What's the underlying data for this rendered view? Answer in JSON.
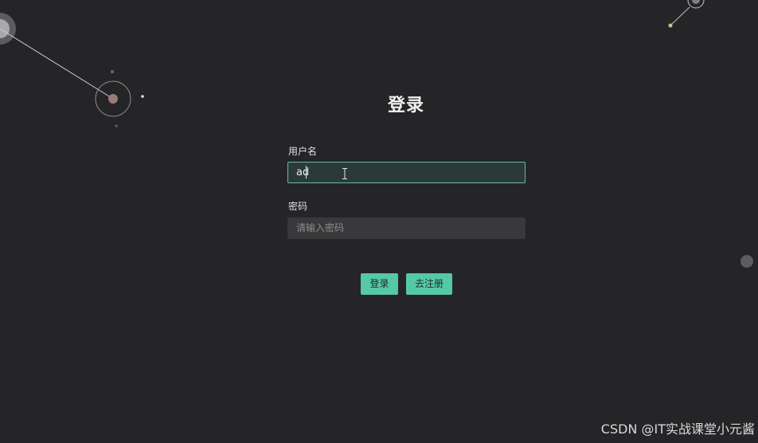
{
  "page": {
    "title": "登录",
    "watermark": "CSDN @IT实战课堂小元酱"
  },
  "form": {
    "username_label": "用户名",
    "username_value": "ad",
    "password_label": "密码",
    "password_placeholder": "请输入密码"
  },
  "actions": {
    "login_label": "登录",
    "register_label": "去注册"
  },
  "colors": {
    "background": "#252528",
    "accent": "#55c9a5",
    "active_field_border": "#5fbfa2",
    "idle_field_bg": "#39393c"
  },
  "icons": {
    "cursor": "text-cursor-icon"
  }
}
